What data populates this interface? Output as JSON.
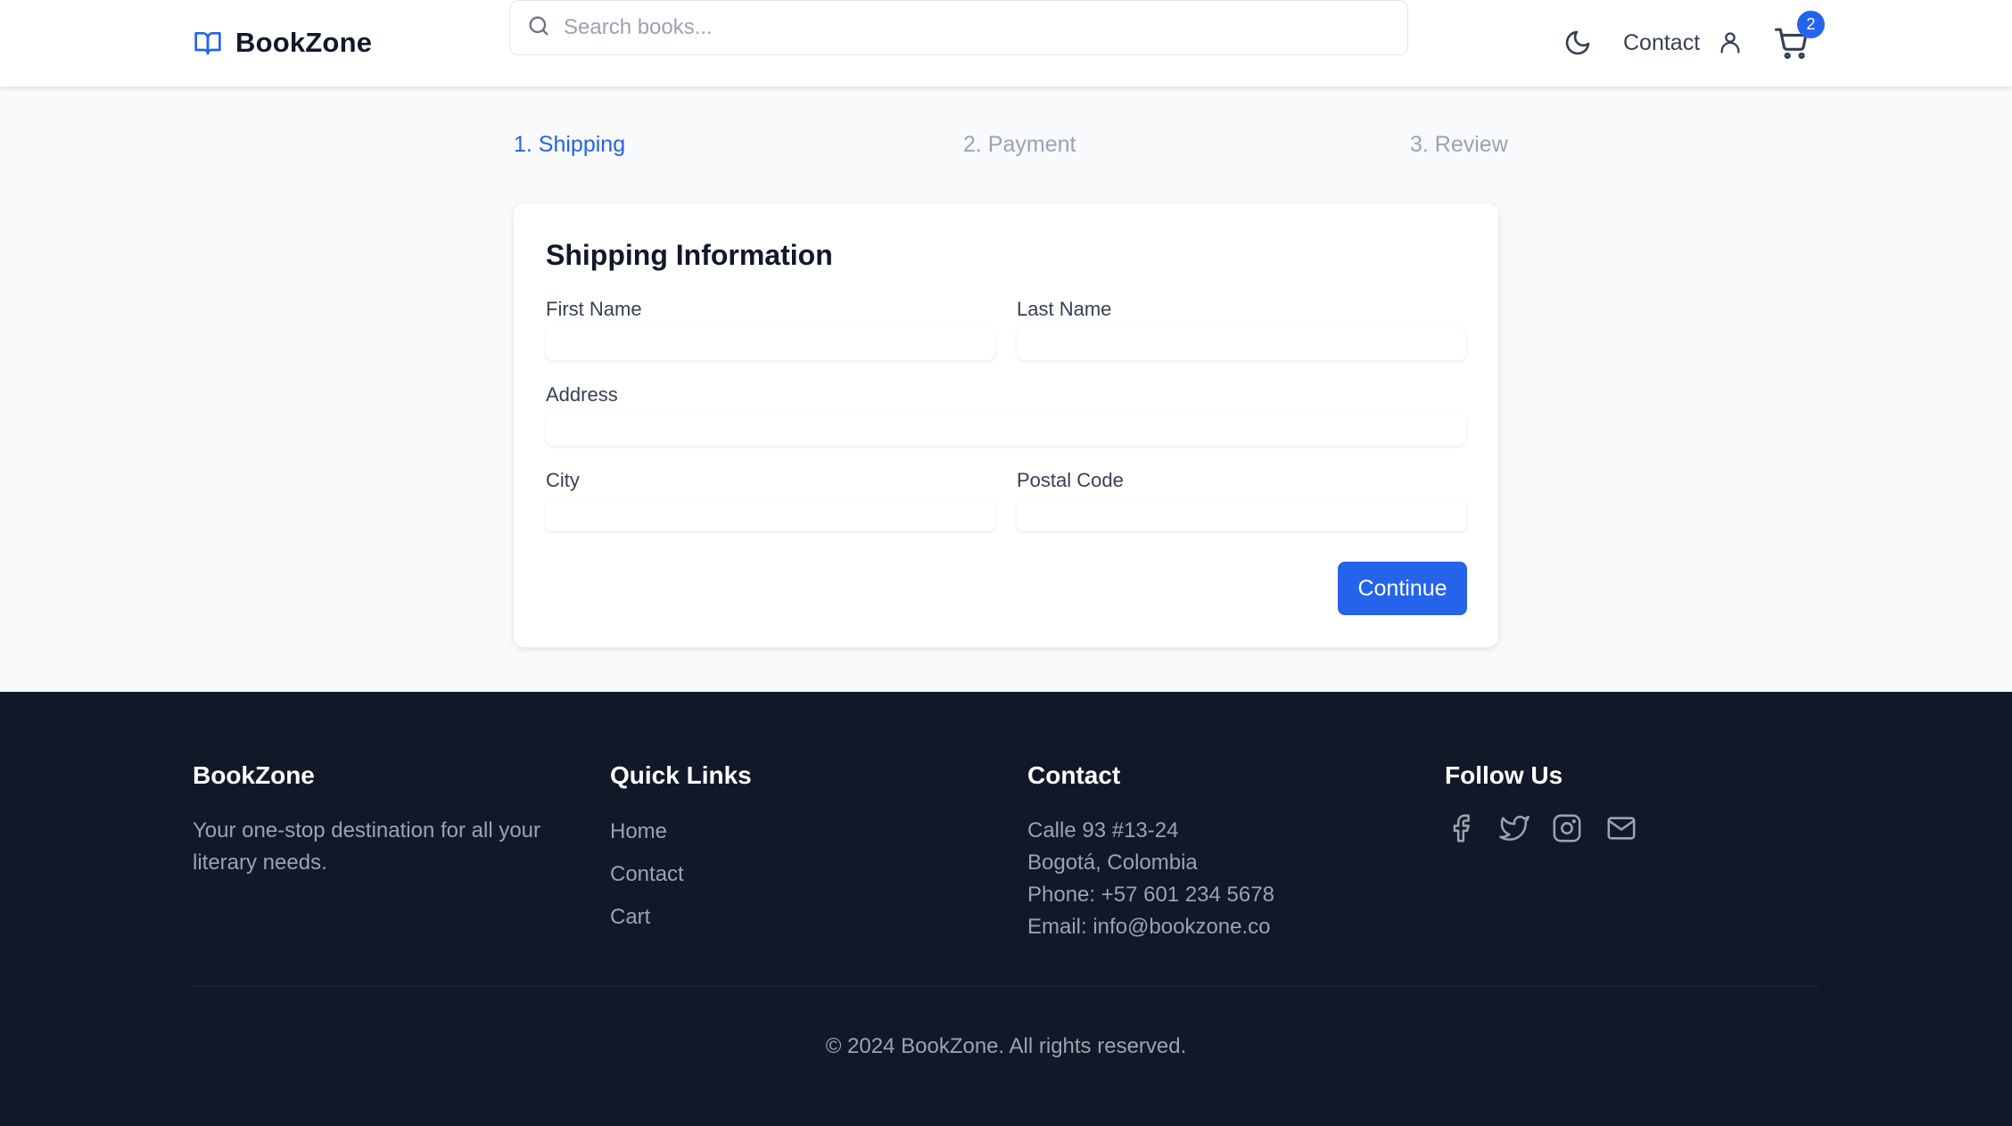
{
  "header": {
    "logo_text": "BookZone",
    "search_placeholder": "Search books...",
    "contact_label": "Contact",
    "cart_count": "2",
    "icons": [
      "book-open-icon",
      "search-icon",
      "moon-icon",
      "user-icon",
      "cart-icon"
    ]
  },
  "steps": [
    {
      "label": "1. Shipping",
      "active": true
    },
    {
      "label": "2. Payment",
      "active": false
    },
    {
      "label": "3. Review",
      "active": false
    }
  ],
  "form": {
    "title": "Shipping Information",
    "first_name_label": "First Name",
    "first_name_value": "",
    "last_name_label": "Last Name",
    "last_name_value": "",
    "address_label": "Address",
    "address_value": "",
    "city_label": "City",
    "city_value": "",
    "postal_code_label": "Postal Code",
    "postal_code_value": "",
    "continue_label": "Continue"
  },
  "footer": {
    "brand_title": "BookZone",
    "brand_desc": "Your one-stop destination for all your literary needs.",
    "links_title": "Quick Links",
    "links": [
      "Home",
      "Contact",
      "Cart"
    ],
    "contact_title": "Contact",
    "contact_lines": [
      "Calle 93 #13-24",
      "Bogotá, Colombia",
      "Phone: +57 601 234 5678",
      "Email: info@bookzone.co"
    ],
    "follow_title": "Follow Us",
    "social_icons": [
      "facebook-icon",
      "twitter-icon",
      "instagram-icon",
      "mail-icon"
    ],
    "copyright": "© 2024 BookZone. All rights reserved."
  },
  "colors": {
    "accent": "#2563eb",
    "footer_bg": "#111827",
    "page_bg": "#f8fafc"
  }
}
